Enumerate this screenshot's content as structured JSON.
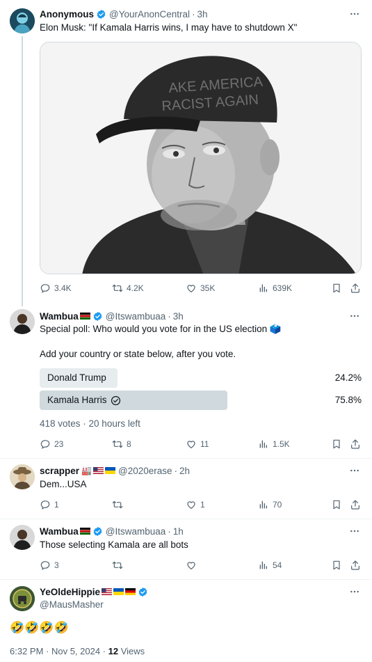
{
  "tweets": [
    {
      "name": "Anonymous",
      "handle": "@YourAnonCentral",
      "time": "3h",
      "text": "Elon Musk: \"If Kamala Harris wins, I may have to shutdown X\"",
      "media_text": [
        "AKE AMERICA",
        "RACIST AGAIN"
      ],
      "stats": {
        "replies": "3.4K",
        "reposts": "4.2K",
        "likes": "35K",
        "views": "639K"
      }
    },
    {
      "name": "Wambua",
      "handle": "@Itswambuaa",
      "time": "3h",
      "text_line1": "Special poll: Who would you vote for in the US election 🗳️",
      "text_line2": "Add your country or state below, after you vote.",
      "poll": {
        "options": [
          {
            "label": "Donald Trump",
            "percent": "24.2%",
            "fraction": 0.242
          },
          {
            "label": "Kamala Harris",
            "percent": "75.8%",
            "fraction": 0.758
          }
        ],
        "meta": "418 votes · 20 hours left"
      },
      "stats": {
        "replies": "23",
        "reposts": "8",
        "likes": "11",
        "views": "1.5K"
      }
    },
    {
      "name": "scrapper",
      "handle": "@2020erase",
      "time": "2h",
      "text": "Dem...USA",
      "stats": {
        "replies": "1",
        "reposts": "",
        "likes": "1",
        "views": "70"
      }
    },
    {
      "name": "Wambua",
      "handle": "@Itswambuaa",
      "time": "1h",
      "text": "Those selecting Kamala are all bots",
      "stats": {
        "replies": "3",
        "reposts": "",
        "likes": "",
        "views": "54"
      }
    },
    {
      "name": "YeOldeHippie",
      "handle": "@MausMasher",
      "text": "🤣🤣🤣🤣",
      "timestamp": "6:32 PM · Nov 5, 2024 · ",
      "views_count": "12",
      "views_label": " Views"
    }
  ],
  "colors": {
    "verified": "#1d9bf0",
    "secondary_text": "#536471",
    "border": "#cfd9de"
  }
}
